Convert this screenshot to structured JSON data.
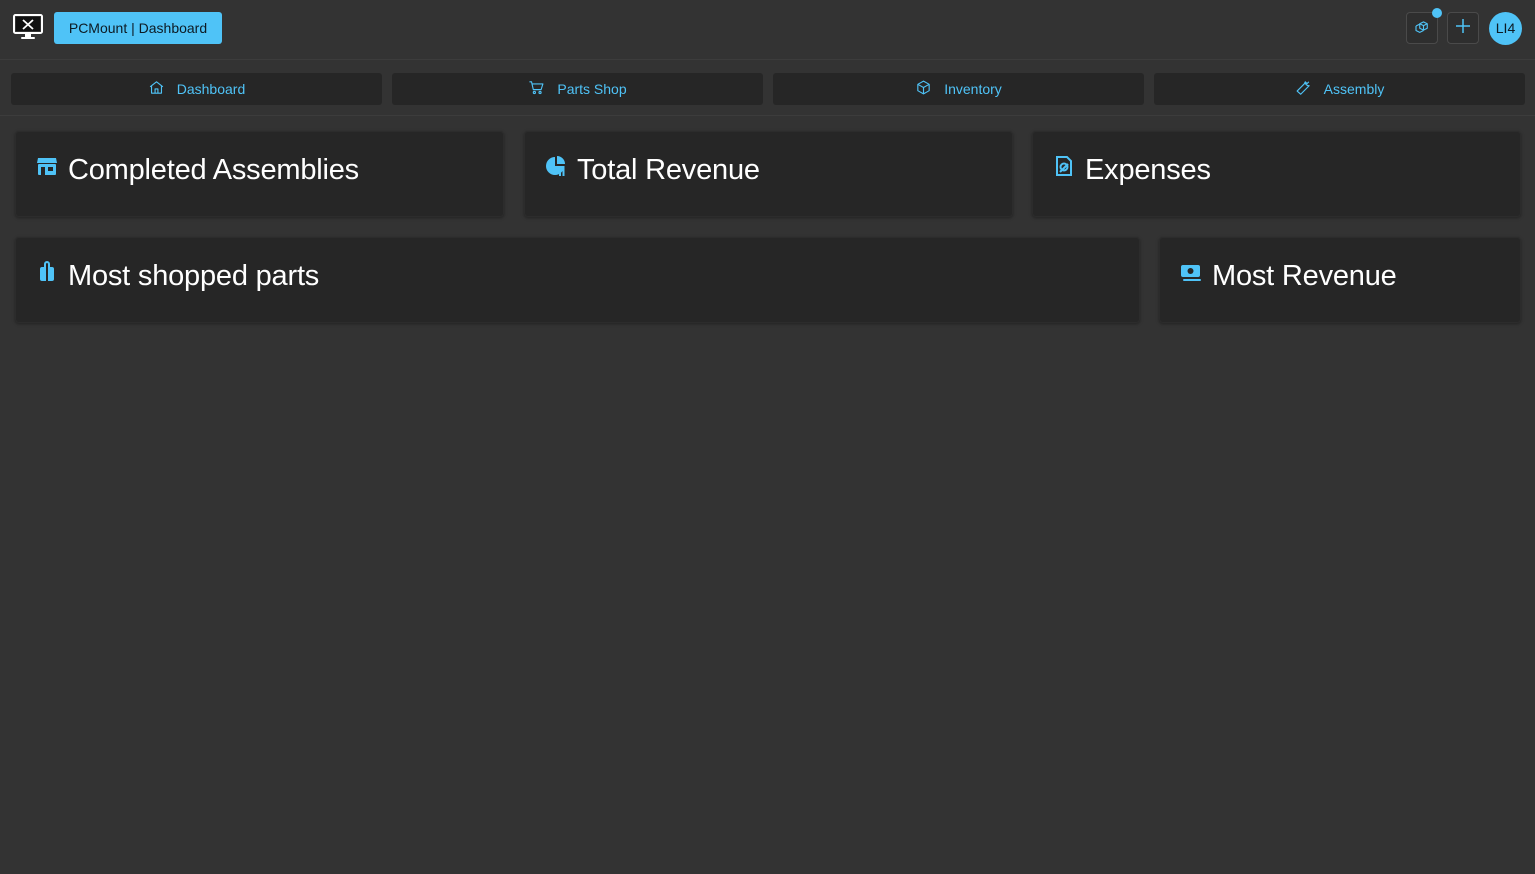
{
  "header": {
    "brand": "PCMount | Dashboard",
    "avatar_initials": "LI4",
    "icons": {
      "logo": "monitor-tools-icon",
      "components": "cubes-icon",
      "add": "plus-icon"
    }
  },
  "nav": {
    "tabs": [
      {
        "label": "Dashboard",
        "icon": "home-icon"
      },
      {
        "label": "Parts Shop",
        "icon": "cart-icon"
      },
      {
        "label": "Inventory",
        "icon": "box-icon"
      },
      {
        "label": "Assembly",
        "icon": "wrench-icon"
      }
    ]
  },
  "cards": {
    "completed_assemblies": {
      "title": "Completed Assemblies",
      "icon": "store-icon"
    },
    "total_revenue": {
      "title": "Total Revenue",
      "icon": "pie-chart-icon"
    },
    "expenses": {
      "title": "Expenses",
      "icon": "receipt-icon"
    },
    "most_shopped_parts": {
      "title": "Most shopped parts",
      "icon": "shopping-bag-icon"
    },
    "most_revenue": {
      "title": "Most Revenue",
      "icon": "money-icon"
    }
  },
  "colors": {
    "accent": "#4fc3f7",
    "background": "#333333",
    "card": "#262626"
  }
}
